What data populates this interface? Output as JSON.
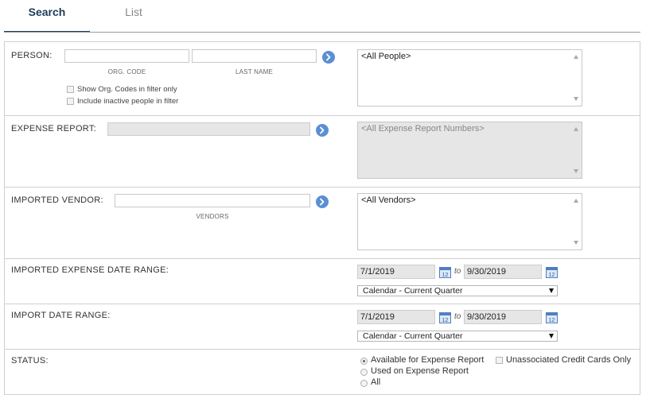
{
  "tabs": [
    {
      "label": "Search",
      "active": true
    },
    {
      "label": "List",
      "active": false
    }
  ],
  "person": {
    "label": "PERSON:",
    "org_code_label": "ORG. CODE",
    "last_name_label": "LAST NAME",
    "org_code_value": "",
    "last_name_value": "",
    "show_org_codes_label": "Show Org. Codes in filter only",
    "include_inactive_label": "Include inactive people in filter",
    "list_option": "<All People>"
  },
  "expense_report": {
    "label": "EXPENSE REPORT:",
    "value": "",
    "list_option": "<All Expense Report Numbers>"
  },
  "imported_vendor": {
    "label": "IMPORTED VENDOR:",
    "vendors_label": "VENDORS",
    "value": "",
    "list_option": "<All Vendors>"
  },
  "imported_expense_date_range": {
    "label": "IMPORTED EXPENSE DATE RANGE:",
    "from": "7/1/2019",
    "to_label": "to",
    "to": "9/30/2019",
    "preset": "Calendar - Current Quarter"
  },
  "import_date_range": {
    "label": "IMPORT DATE RANGE:",
    "from": "7/1/2019",
    "to_label": "to",
    "to": "9/30/2019",
    "preset": "Calendar - Current Quarter"
  },
  "status": {
    "label": "STATUS:",
    "options": [
      {
        "label": "Available for Expense Report",
        "selected": true
      },
      {
        "label": "Used on Expense Report",
        "selected": false
      },
      {
        "label": "All",
        "selected": false
      }
    ],
    "unassociated_label": "Unassociated Credit Cards Only",
    "unassociated_checked": false
  },
  "icons": {
    "go_button": "arrow-right-circle-icon",
    "calendar": "calendar-icon",
    "calendar_day": "12"
  },
  "colors": {
    "accent": "#1f3c5a",
    "go_button": "#5b8fd3",
    "disabled_bg": "#e6e6e6"
  }
}
